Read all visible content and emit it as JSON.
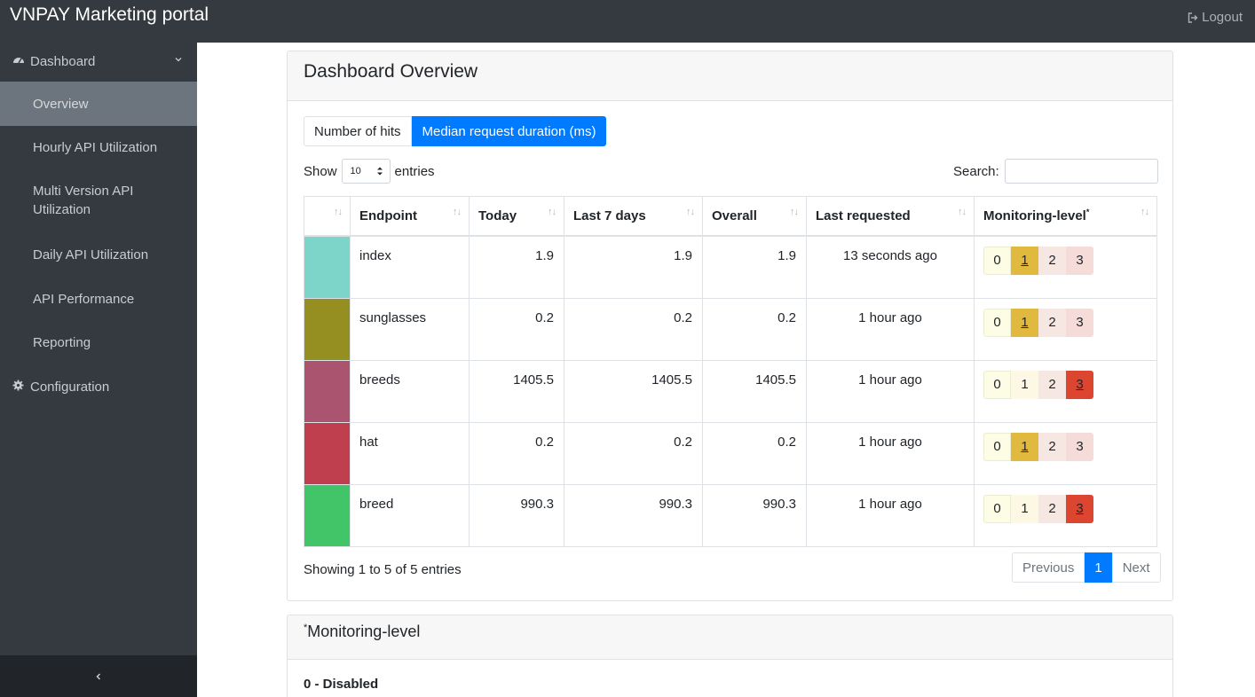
{
  "header": {
    "brand": "VNPAY Marketing portal",
    "logout_label": "Logout",
    "logout_icon": "sign-out-icon"
  },
  "sidebar": {
    "dashboard_label": "Dashboard",
    "configuration_label": "Configuration",
    "items": [
      {
        "label": "Overview",
        "active": true
      },
      {
        "label": "Hourly API Utilization"
      },
      {
        "label": "Multi Version API Utilization"
      },
      {
        "label": "Daily API Utilization"
      },
      {
        "label": "API Performance"
      },
      {
        "label": "Reporting"
      }
    ],
    "collapse_icon": "chevron-left-icon"
  },
  "overview": {
    "title": "Dashboard Overview",
    "tabs": [
      "Number of hits",
      "Median request duration (ms)"
    ],
    "active_tab": "Median request duration (ms)",
    "show_label": "Show",
    "entries_value": "10",
    "entries_label": "entries",
    "search_label": "Search:",
    "search_value": "",
    "columns": [
      "",
      "Endpoint",
      "Today",
      "Last 7 days",
      "Overall",
      "Last requested",
      "Monitoring-level"
    ],
    "monitoring_sup": "*",
    "rows": [
      {
        "color": "#7dd4c8",
        "endpoint": "index",
        "today": "1.9",
        "last7": "1.9",
        "overall": "1.9",
        "last_requested": "13 seconds ago",
        "level": 1
      },
      {
        "color": "#958e20",
        "endpoint": "sunglasses",
        "today": "0.2",
        "last7": "0.2",
        "overall": "0.2",
        "last_requested": "1 hour ago",
        "level": 1
      },
      {
        "color": "#aa5470",
        "endpoint": "breeds",
        "today": "1405.5",
        "last7": "1405.5",
        "overall": "1405.5",
        "last_requested": "1 hour ago",
        "level": 3
      },
      {
        "color": "#c03f4f",
        "endpoint": "hat",
        "today": "0.2",
        "last7": "0.2",
        "overall": "0.2",
        "last_requested": "1 hour ago",
        "level": 1
      },
      {
        "color": "#42c468",
        "endpoint": "breed",
        "today": "990.3",
        "last7": "990.3",
        "overall": "990.3",
        "last_requested": "1 hour ago",
        "level": 3
      }
    ],
    "level_labels": [
      "0",
      "1",
      "2",
      "3"
    ],
    "info": "Showing 1 to 5 of 5 entries",
    "pager": {
      "previous": "Previous",
      "current": "1",
      "next": "Next"
    }
  },
  "monitoring_card": {
    "sup": "*",
    "title": "Monitoring-level",
    "first_line": "0 - Disabled"
  }
}
